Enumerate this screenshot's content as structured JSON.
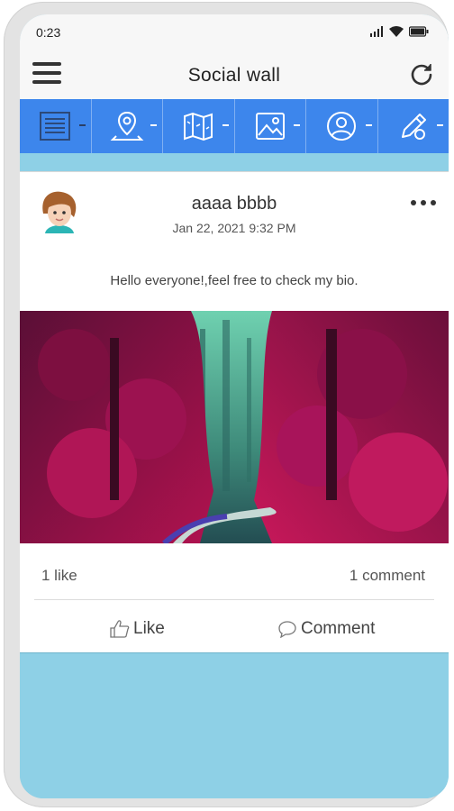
{
  "status": {
    "time": "0:23",
    "icons": [
      "signal-icon",
      "wifi-icon",
      "battery-icon"
    ]
  },
  "appbar": {
    "title": "Social wall",
    "menu_icon": "hamburger-menu-icon",
    "refresh_icon": "refresh-icon"
  },
  "tabs": [
    {
      "icon": "news-feed-icon",
      "active": true
    },
    {
      "icon": "location-pin-icon",
      "active": false
    },
    {
      "icon": "map-icon",
      "active": false
    },
    {
      "icon": "gallery-icon",
      "active": false
    },
    {
      "icon": "profile-icon",
      "active": false
    },
    {
      "icon": "edit-pencil-icon",
      "active": false
    }
  ],
  "post": {
    "author": "aaaa bbbb",
    "date": "Jan 22, 2021 9:32 PM",
    "caption": "Hello everyone!,feel free to check my bio.",
    "like_count": "1 like",
    "comment_count": "1 comment",
    "like_label": "Like",
    "comment_label": "Comment"
  },
  "colors": {
    "tab_bar": "#3d86ec",
    "feed_background": "#8ed0e6",
    "appbar": "#f7f7f7"
  }
}
